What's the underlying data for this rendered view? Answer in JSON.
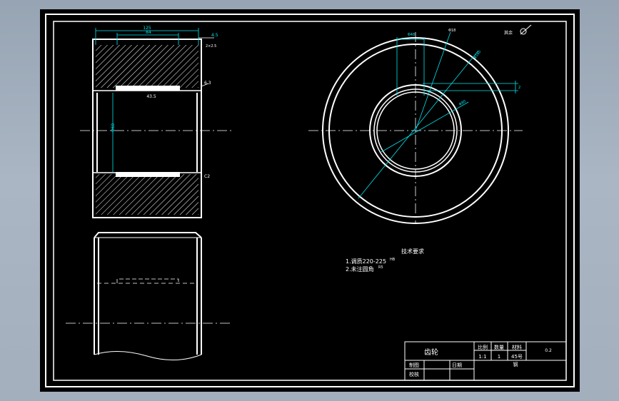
{
  "drawing": {
    "part_name": "齿轮",
    "tech_requirements": {
      "title": "技术要求",
      "line1": "1.调质220-225",
      "line1_sup": "HB",
      "line2": "2.未注圆角",
      "line2_sup": "R5"
    },
    "roughness_note": "其余",
    "dims": {
      "top_width": "125",
      "top_inner": "84",
      "chamfer_top": "4.5",
      "chamfer_small": "2×2.5",
      "side_right": "6.3",
      "bore_width": "43.5",
      "bore_dia": "Φ60",
      "right_bottom": "C2",
      "circle_top": "Φ48",
      "circle_right": "Φ18",
      "circle_diag": "Φ160",
      "circle_diag2": "Φ80",
      "side_small": "2"
    },
    "title_block": {
      "scale_label": "比例",
      "qty_label": "数量",
      "material_label": "材料",
      "scale_value": "1:1",
      "qty_value": "1",
      "material_value": "45号",
      "drawn_label": "制图",
      "checked_label": "校核",
      "date_label": "日期",
      "footer_text": "钢",
      "drawing_no": "0.2"
    }
  }
}
